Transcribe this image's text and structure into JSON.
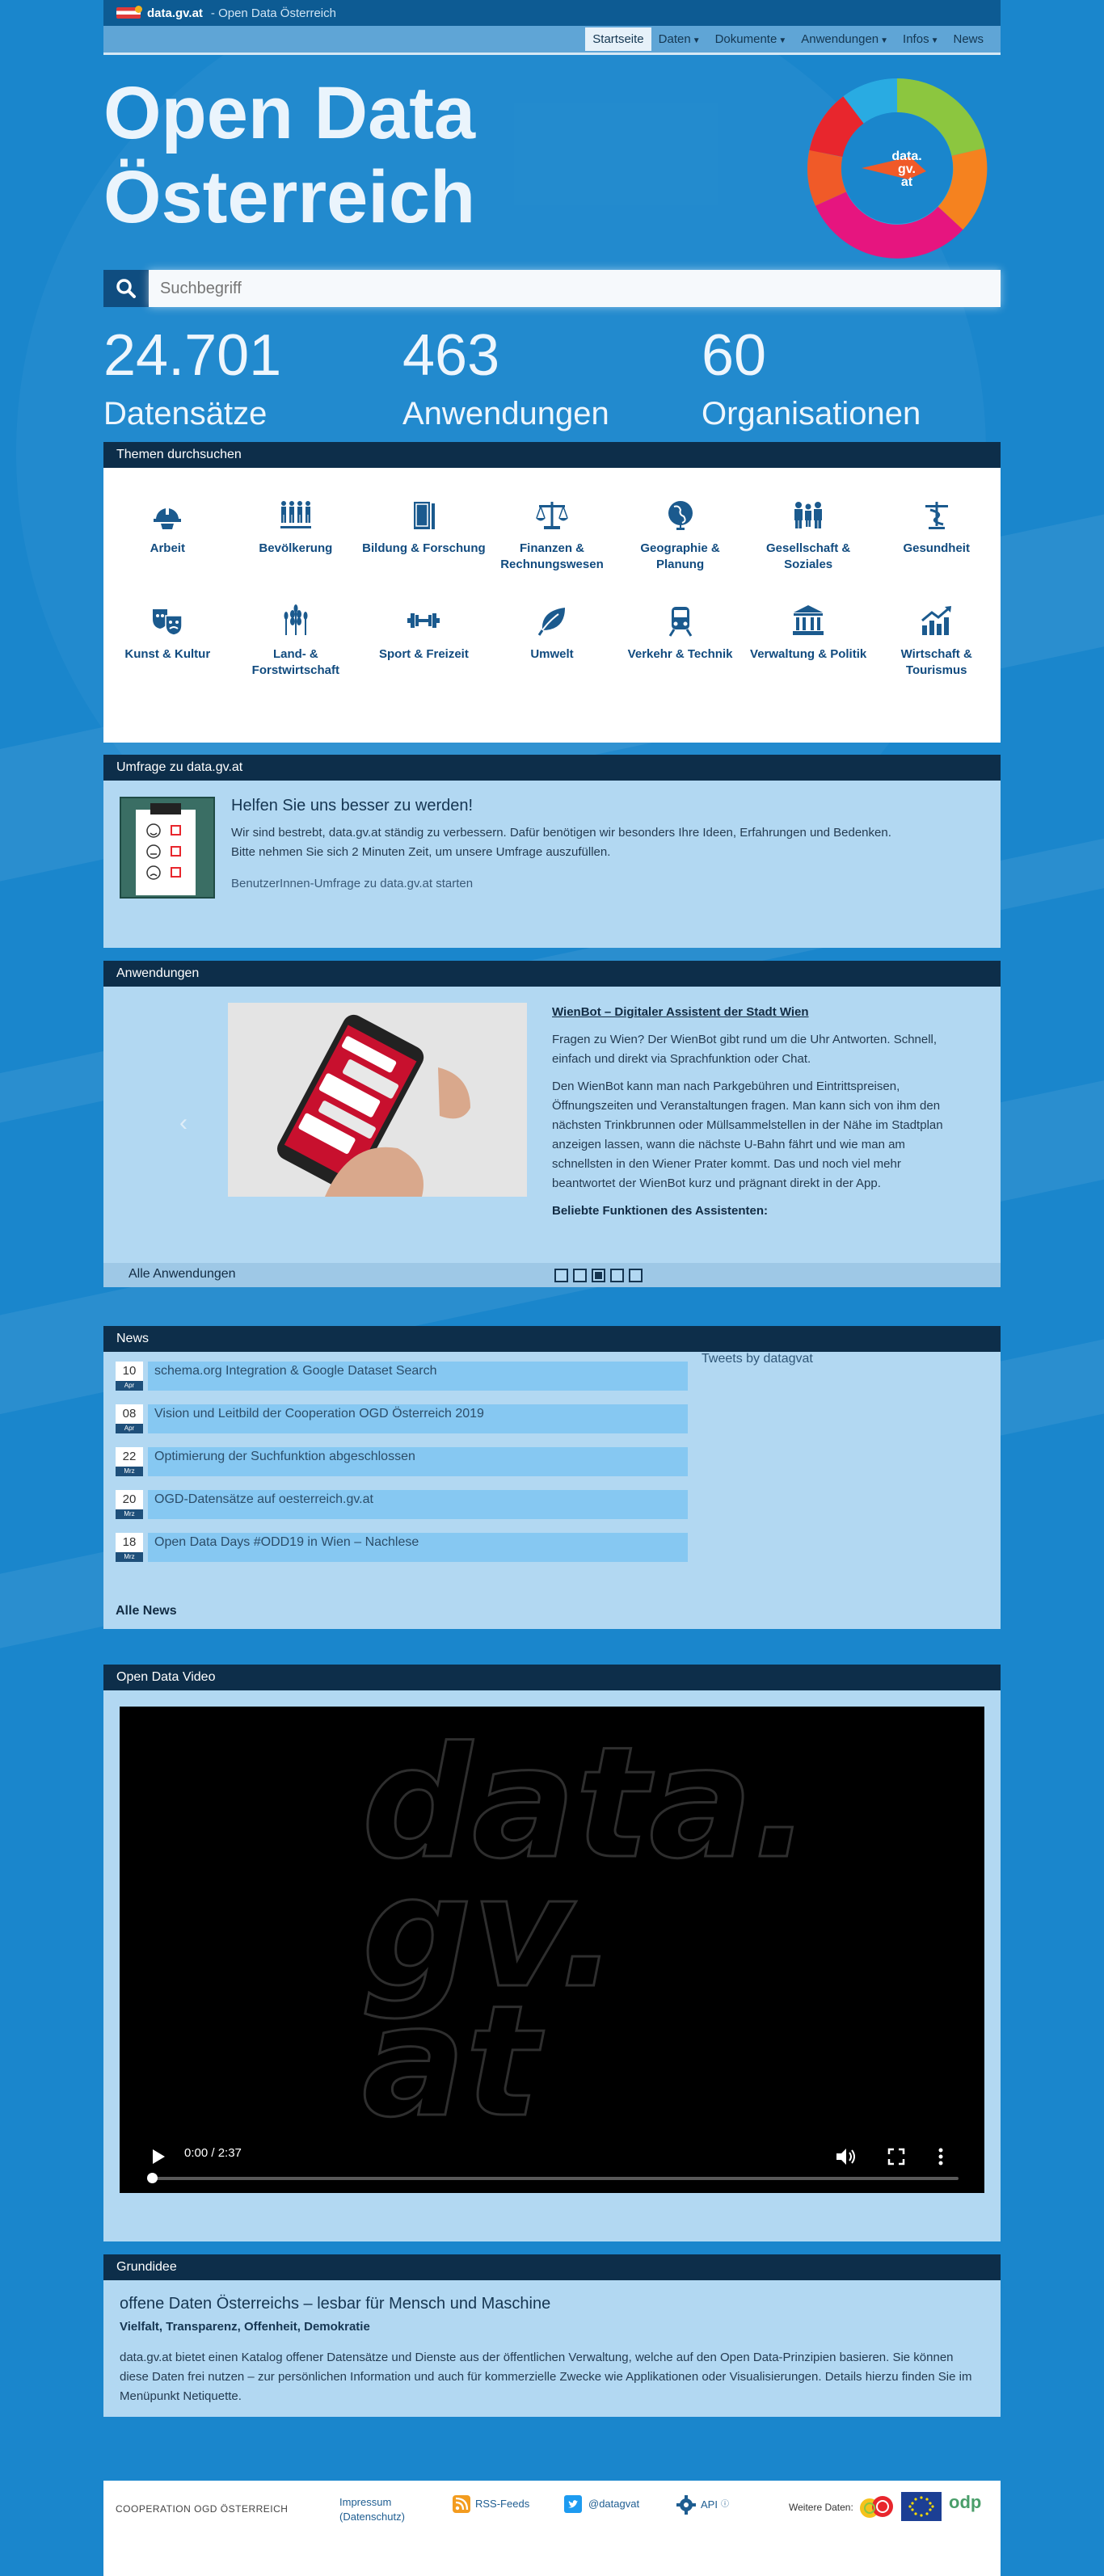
{
  "topbar": {
    "site": "data.gv.at",
    "subtitle": "- Open Data Österreich"
  },
  "menu": [
    {
      "label": "Startseite",
      "active": true,
      "dropdown": false
    },
    {
      "label": "Daten",
      "active": false,
      "dropdown": true
    },
    {
      "label": "Dokumente",
      "active": false,
      "dropdown": true
    },
    {
      "label": "Anwendungen",
      "active": false,
      "dropdown": true
    },
    {
      "label": "Infos",
      "active": false,
      "dropdown": true
    },
    {
      "label": "News",
      "active": false,
      "dropdown": false
    }
  ],
  "hero": {
    "title_line1": "Open Data",
    "title_line2": "Österreich",
    "logo_text": "data. gv. at"
  },
  "search": {
    "placeholder": "Suchbegriff"
  },
  "stats": [
    {
      "value": "24.701",
      "label": "Datensätze"
    },
    {
      "value": "463",
      "label": "Anwendungen"
    },
    {
      "value": "60",
      "label": "Organisationen"
    }
  ],
  "themes": {
    "header": "Themen durchsuchen",
    "items": [
      {
        "label": "Arbeit",
        "icon": "helmet-icon"
      },
      {
        "label": "Bevölkerung",
        "icon": "people-group-icon"
      },
      {
        "label": "Bildung & Forschung",
        "icon": "book-icon"
      },
      {
        "label": "Finanzen & Rechnungswesen",
        "icon": "scales-icon"
      },
      {
        "label": "Geographie & Planung",
        "icon": "globe-icon"
      },
      {
        "label": "Gesellschaft & Soziales",
        "icon": "family-icon"
      },
      {
        "label": "Gesundheit",
        "icon": "caduceus-icon"
      },
      {
        "label": "Kunst & Kultur",
        "icon": "masks-icon"
      },
      {
        "label": "Land- & Forstwirtschaft",
        "icon": "wheat-icon"
      },
      {
        "label": "Sport & Freizeit",
        "icon": "dumbbell-icon"
      },
      {
        "label": "Umwelt",
        "icon": "leaf-icon"
      },
      {
        "label": "Verkehr & Technik",
        "icon": "train-icon"
      },
      {
        "label": "Verwaltung & Politik",
        "icon": "building-icon"
      },
      {
        "label": "Wirtschaft & Tourismus",
        "icon": "chart-trend-icon"
      }
    ]
  },
  "survey": {
    "header": "Umfrage zu data.gv.at",
    "title": "Helfen Sie uns besser zu werden!",
    "text1": "Wir sind bestrebt, data.gv.at ständig zu verbessern. Dafür benötigen wir besonders Ihre Ideen, Erfahrungen und Bedenken.",
    "text2": "Bitte nehmen Sie sich 2 Minuten Zeit, um unsere Umfrage auszufüllen.",
    "link": "BenutzerInnen-Umfrage zu data.gv.at starten"
  },
  "apps": {
    "header": "Anwendungen",
    "item_title": "WienBot – Digitaler Assistent der Stadt Wien",
    "para1": "Fragen zu Wien? Der WienBot gibt rund um die Uhr Antworten. Schnell, einfach und direkt via Sprachfunktion oder Chat.",
    "para2": "Den WienBot kann man nach Parkgebühren und Eintrittspreisen, Öffnungszeiten und Veranstaltungen fragen. Man kann sich von ihm den nächsten Trinkbrunnen oder Müllsammelstellen in der Nähe im Stadtplan anzeigen lassen, wann die nächste U-Bahn fährt und wie man am schnellsten in den Wiener Prater kommt. Das und noch viel mehr beantwortet der WienBot kurz und prägnant direkt in der App.",
    "features": "Beliebte Funktionen des Assistenten:",
    "all": "Alle Anwendungen",
    "active_slide": 3,
    "slides": 5
  },
  "news": {
    "header": "News",
    "items": [
      {
        "day": "10",
        "month": "Apr",
        "title": "schema.org Integration & Google Dataset Search"
      },
      {
        "day": "08",
        "month": "Apr",
        "title": "Vision und Leitbild der Cooperation OGD Österreich 2019"
      },
      {
        "day": "22",
        "month": "Mrz",
        "title": "Optimierung der Suchfunktion abgeschlossen"
      },
      {
        "day": "20",
        "month": "Mrz",
        "title": "OGD-Datensätze auf oesterreich.gv.at"
      },
      {
        "day": "18",
        "month": "Mrz",
        "title": "Open Data Days #ODD19 in Wien – Nachlese"
      }
    ],
    "all": "Alle News",
    "tweets": "Tweets by datagvat"
  },
  "video": {
    "header": "Open Data Video",
    "watermark_lines": [
      "data.",
      "gv.",
      "at"
    ],
    "time": "0:00 / 2:37"
  },
  "grund": {
    "header": "Grundidee",
    "title": "offene Daten Österreichs – lesbar für Mensch und Maschine",
    "tagline": "Vielfalt, Transparenz, Offenheit, Demokratie",
    "text": "data.gv.at bietet einen Katalog offener Datensätze und Dienste aus der öffentlichen Verwaltung, welche auf den Open Data-Prinzipien basieren. Sie können diese Daten frei nutzen – zur persönlichen Information und auch für kommerzielle Zwecke wie Applikationen oder Visualisierungen. Details hierzu finden Sie im Menüpunkt Netiquette."
  },
  "footer": {
    "coop": "COOPERATION OGD ÖSTERREICH",
    "impressum": "Impressum",
    "datenschutz": "(Datenschutz)",
    "rss": "RSS-Feeds",
    "twitter": "@datagvat",
    "api": "API",
    "more": "Weitere Daten:",
    "odp": "odp"
  },
  "colors": {
    "accent": "#1a86cc",
    "dark": "#0d2e4a",
    "panel": "#b2d8f2",
    "logo_ring": [
      "#f5821f",
      "#e6157f",
      "#e8262d",
      "#f05a28",
      "#8cc63f",
      "#29abe2"
    ]
  }
}
